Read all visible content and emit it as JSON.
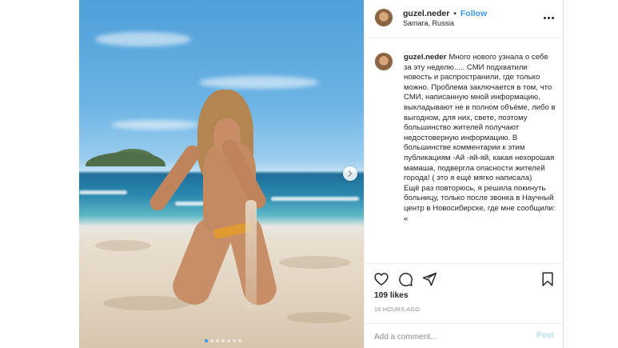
{
  "header": {
    "username": "guzel.neder",
    "separator": "•",
    "follow_label": "Follow",
    "location": "Samara, Russia",
    "more_icon": "more-options-icon"
  },
  "caption": {
    "username": "guzel.neder",
    "text": "Много нового узнала о себе за эту неделю..... СМИ подхватили новость и распространили, где только можно. Проблема заключается в том, что СМИ, написанную мной информацию, выкладывают не в полном объёме, либо в выгодном, для них, свете, поэтому большинство жителей получают недостоверную информацию. В большинстве комментарии к этим публикациям -Ай -яй-яй, какая нехорошая мамаша, подвергла опасности жителей города! ( это я ещё мягко написала)\nЕщё раз повторюсь, я решила покинуть больницу, только после звонка в Научный центр в Новосибирске, где мне сообщили: «"
  },
  "actions": {
    "like_icon": "heart-icon",
    "comment_icon": "comment-icon",
    "share_icon": "share-icon",
    "save_icon": "bookmark-icon",
    "likes": "109 likes",
    "time": "16 HOURS AGO"
  },
  "comment_box": {
    "placeholder": "Add a comment...",
    "post_label": "Post"
  },
  "carousel": {
    "total_slides": 7,
    "active_slide": 1
  },
  "colors": {
    "accent": "#3897f0",
    "post_disabled": "#b2dffc",
    "muted": "#8e8e8e"
  }
}
